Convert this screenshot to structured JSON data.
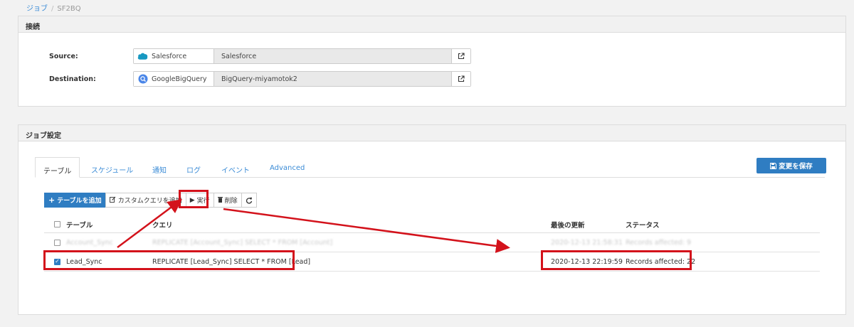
{
  "breadcrumb": {
    "root": "ジョブ",
    "separator": "/",
    "current": "SF2BQ"
  },
  "connection": {
    "title": "接続",
    "source": {
      "label": "Source:",
      "type": "Salesforce",
      "name": "Salesforce",
      "icon": "salesforce-icon"
    },
    "destination": {
      "label": "Destination:",
      "type": "GoogleBigQuery",
      "name": "BigQuery-miyamotok2",
      "icon": "bigquery-icon"
    }
  },
  "job": {
    "title": "ジョブ設定",
    "tabs": [
      "テーブル",
      "スケジュール",
      "通知",
      "ログ",
      "イベント",
      "Advanced"
    ],
    "save_label": "変更を保存",
    "toolbar": {
      "add_table": "テーブルを追加",
      "add_custom_query": "カスタムクエリを追加",
      "run": "実行",
      "delete": "削除"
    },
    "table": {
      "headers": {
        "table": "テーブル",
        "query": "クエリ",
        "last_updated": "最後の更新",
        "status": "ステータス"
      },
      "rows": [
        {
          "checked": false,
          "table": "Account_Sync",
          "query": "REPLICATE [Account_Sync] SELECT * FROM [Account]",
          "last_updated": "2020-12-13 21:58:31",
          "status": "Records affected: 9"
        },
        {
          "checked": true,
          "table": "Lead_Sync",
          "query": "REPLICATE [Lead_Sync] SELECT * FROM [Lead]",
          "last_updated": "2020-12-13 22:19:59",
          "status": "Records affected: 22"
        }
      ]
    }
  },
  "colors": {
    "accent": "#2f7dc2",
    "annotation": "#d3121b"
  }
}
